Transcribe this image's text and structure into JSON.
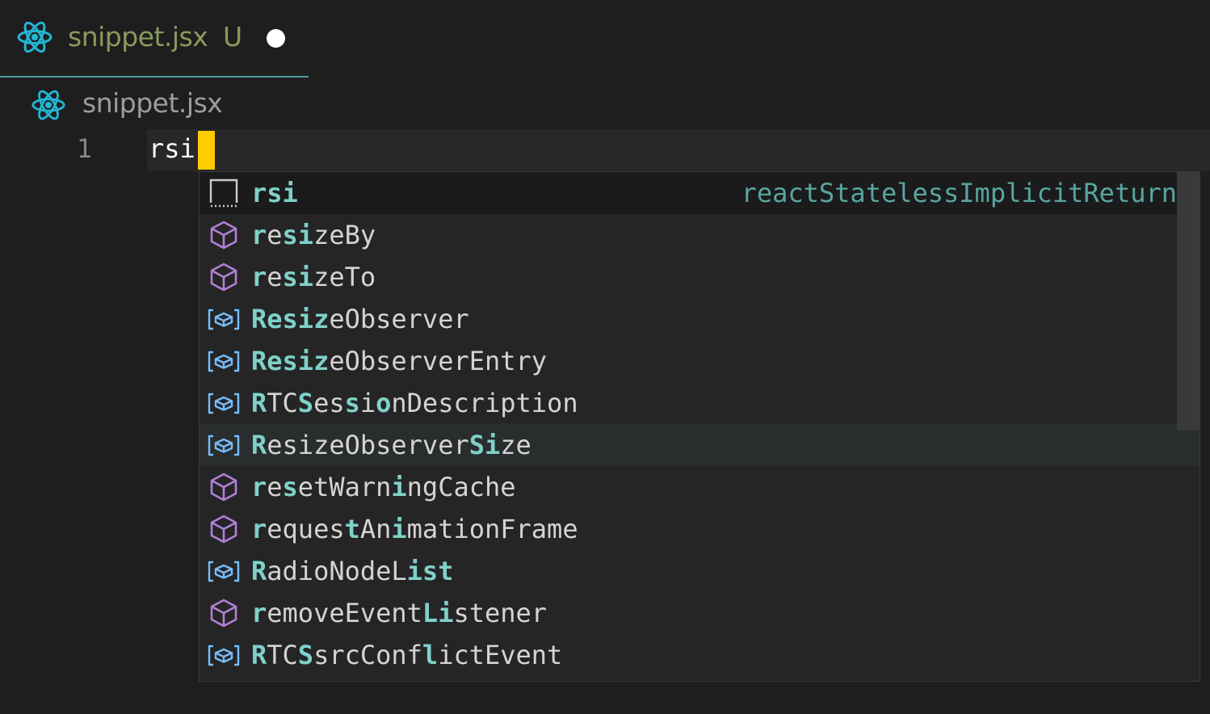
{
  "tab": {
    "title": "snippet.jsx",
    "status": "U",
    "icon": "react-icon"
  },
  "breadcrumb": {
    "label": "snippet.jsx",
    "icon": "react-icon"
  },
  "editor": {
    "line_number": "1",
    "code": "rsi"
  },
  "colors": {
    "accent": "#4a9fa8",
    "match": "#7fd1c9",
    "cursor": "#ffcc00",
    "tab_text": "#8a9a5b",
    "method_icon": "#b180d7",
    "class_icon": "#75beff"
  },
  "suggestions": [
    {
      "label": "rsi",
      "detail": "reactStatelessImplicitReturn",
      "kind": "snippet-icon",
      "match": [
        0,
        1,
        2
      ]
    },
    {
      "label": "resizeBy",
      "detail": "",
      "kind": "method-icon",
      "match": [
        0,
        2,
        3
      ]
    },
    {
      "label": "resizeTo",
      "detail": "",
      "kind": "method-icon",
      "match": [
        0,
        2,
        3
      ]
    },
    {
      "label": "ResizeObserver",
      "detail": "",
      "kind": "class-icon",
      "match": [
        0,
        1,
        2,
        3,
        4
      ]
    },
    {
      "label": "ResizeObserverEntry",
      "detail": "",
      "kind": "class-icon",
      "match": [
        0,
        1,
        2,
        3,
        4
      ]
    },
    {
      "label": "RTCSessionDescription",
      "detail": "",
      "kind": "class-icon",
      "match": [
        0,
        3,
        6,
        8
      ]
    },
    {
      "label": "ResizeObserverSize",
      "detail": "",
      "kind": "class-icon",
      "match": [
        0,
        14,
        15
      ]
    },
    {
      "label": "resetWarningCache",
      "detail": "",
      "kind": "method-icon",
      "match": [
        0,
        2,
        9
      ]
    },
    {
      "label": "requestAnimationFrame",
      "detail": "",
      "kind": "method-icon",
      "match": [
        0,
        6,
        9
      ]
    },
    {
      "label": "RadioNodeList",
      "detail": "",
      "kind": "class-icon",
      "match": [
        0,
        10,
        11,
        12
      ]
    },
    {
      "label": "removeEventListener",
      "detail": "",
      "kind": "method-icon",
      "match": [
        0,
        11,
        12
      ]
    },
    {
      "label": "RTCSsrcConflictEvent",
      "detail": "",
      "kind": "class-icon",
      "match": [
        0,
        3,
        11
      ]
    }
  ]
}
